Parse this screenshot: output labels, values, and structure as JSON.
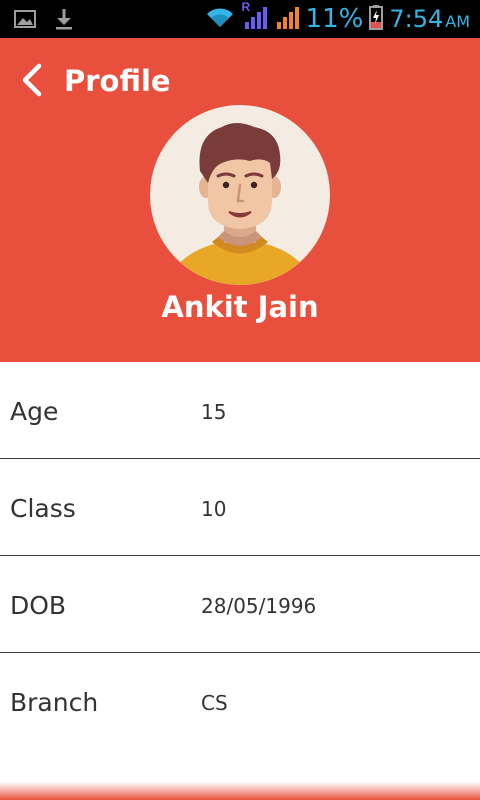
{
  "status_bar": {
    "battery_percent": "11%",
    "time": "7:54",
    "ampm": "AM",
    "network_badge": "R",
    "icons": [
      "gallery-icon",
      "download-icon",
      "wifi-icon",
      "signal-icon",
      "signal-icon",
      "battery-charging-icon"
    ]
  },
  "header": {
    "title": "Profile",
    "back_icon": "chevron-left-icon",
    "background_color": "#e8503d"
  },
  "profile": {
    "name": "Ankit Jain",
    "avatar_icon": "avatar-illustration"
  },
  "details": [
    {
      "label": "Age",
      "value": "15"
    },
    {
      "label": "Class",
      "value": "10"
    },
    {
      "label": "DOB",
      "value": "28/05/1996"
    },
    {
      "label": "Branch",
      "value": "CS"
    }
  ]
}
